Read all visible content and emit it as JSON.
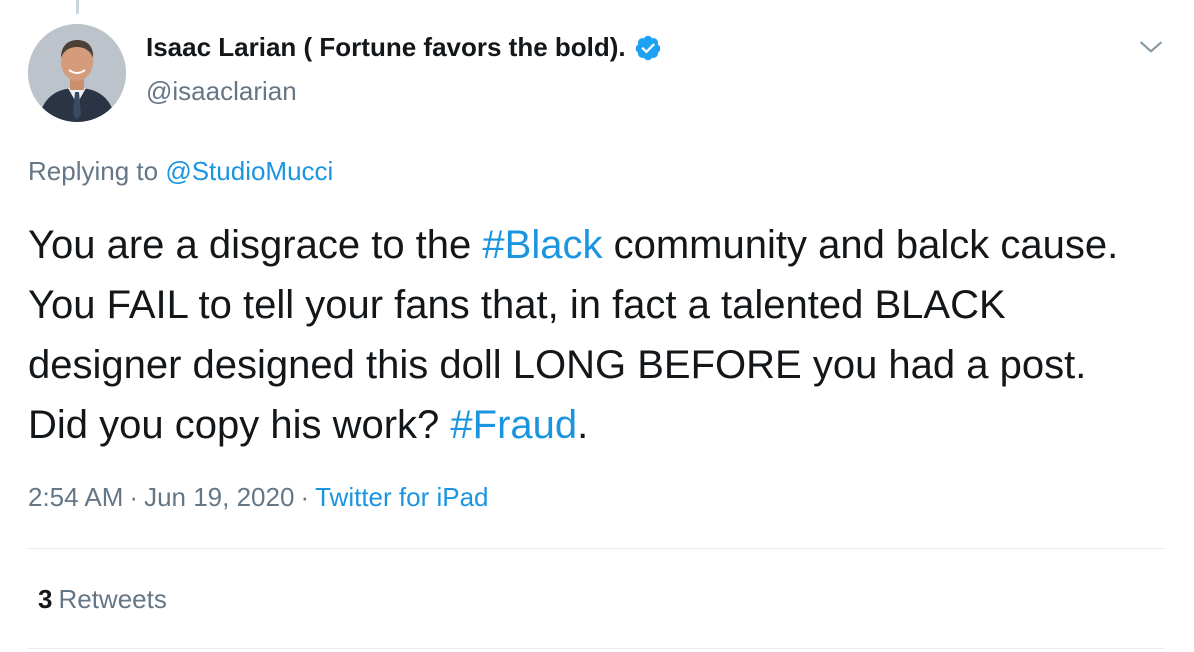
{
  "author": {
    "display_name": "Isaac Larian ( Fortune favors the bold).",
    "handle": "@isaaclarian",
    "verified": true
  },
  "reply": {
    "prefix": "Replying to",
    "to_handle": "@StudioMucci"
  },
  "tweet": {
    "segments": [
      {
        "type": "text",
        "value": "You are a disgrace to the "
      },
      {
        "type": "hashtag",
        "value": "#Black"
      },
      {
        "type": "text",
        "value": " community and balck cause. You FAIL to tell your fans that, in fact a talented BLACK designer designed this doll LONG BEFORE you had a post. Did you copy his work? "
      },
      {
        "type": "hashtag",
        "value": "#Fraud"
      },
      {
        "type": "text",
        "value": "."
      }
    ]
  },
  "meta": {
    "time": "2:54 AM",
    "separator": "·",
    "date": "Jun 19, 2020",
    "source": "Twitter for iPad"
  },
  "stats": {
    "retweets_count": "3",
    "retweets_label": "Retweets"
  },
  "colors": {
    "link": "#1b95e0",
    "text": "#14171a",
    "muted": "#657786",
    "verified": "#1da1f2",
    "divider": "#e6ecf0"
  },
  "icons": {
    "verified": "verified-badge-icon",
    "more": "chevron-down-icon"
  }
}
